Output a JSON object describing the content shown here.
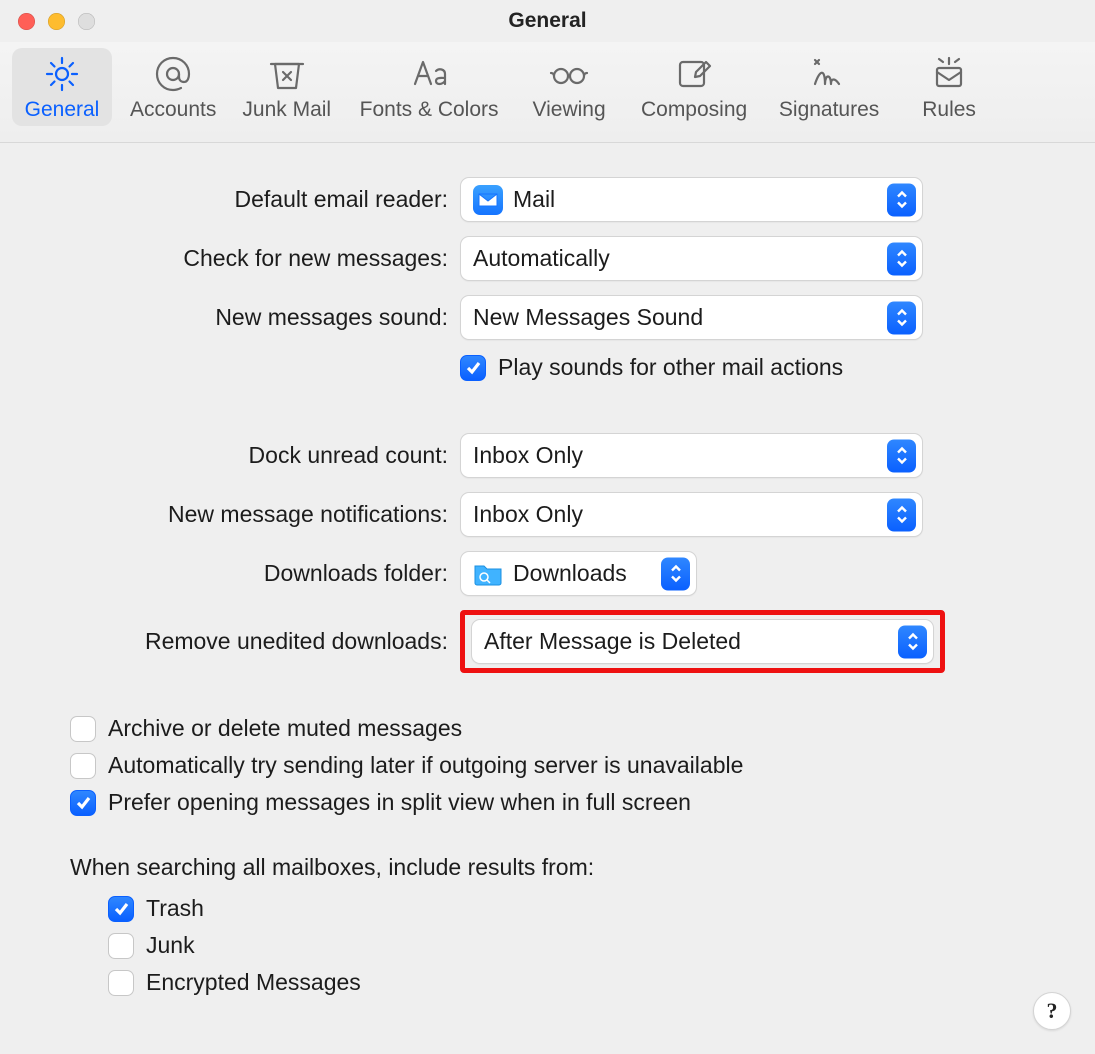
{
  "window": {
    "title": "General"
  },
  "toolbar": {
    "items": [
      {
        "label": "General"
      },
      {
        "label": "Accounts"
      },
      {
        "label": "Junk Mail"
      },
      {
        "label": "Fonts & Colors"
      },
      {
        "label": "Viewing"
      },
      {
        "label": "Composing"
      },
      {
        "label": "Signatures"
      },
      {
        "label": "Rules"
      }
    ]
  },
  "labels": {
    "default_reader": "Default email reader:",
    "check_messages": "Check for new messages:",
    "new_sound": "New messages sound:",
    "play_sounds": "Play sounds for other mail actions",
    "dock_unread": "Dock unread count:",
    "new_notifications": "New message notifications:",
    "downloads_folder": "Downloads folder:",
    "remove_unedited": "Remove unedited downloads:",
    "archive_muted": "Archive or delete muted messages",
    "auto_retry": "Automatically try sending later if outgoing server is unavailable",
    "split_view": "Prefer opening messages in split view when in full screen",
    "search_heading": "When searching all mailboxes, include results from:",
    "trash": "Trash",
    "junk": "Junk",
    "encrypted": "Encrypted Messages"
  },
  "values": {
    "default_reader": "Mail",
    "check_messages": "Automatically",
    "new_sound": "New Messages Sound",
    "dock_unread": "Inbox Only",
    "new_notifications": "Inbox Only",
    "downloads_folder": "Downloads",
    "remove_unedited": "After Message is Deleted"
  },
  "checks": {
    "play_sounds": true,
    "archive_muted": false,
    "auto_retry": false,
    "split_view": true,
    "trash": true,
    "junk": false,
    "encrypted": false
  },
  "help": "?"
}
